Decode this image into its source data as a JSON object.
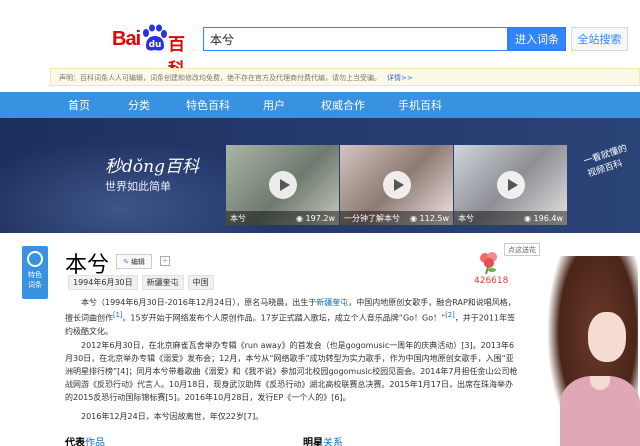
{
  "header": {
    "logo_bai": "Bai",
    "logo_baike": "百科",
    "search_value": "本兮",
    "enter_button": "进入词条",
    "all_search_button": "全站搜索"
  },
  "notice": {
    "text": "声明：百科词条人人可编辑，词条创建和修改均免费，绝不存在官方及代理商付费代编，请勿上当受骗。",
    "more": "详情>>"
  },
  "nav": {
    "items": [
      "首页",
      "分类",
      "特色百科",
      "用户",
      "权威合作",
      "手机百科"
    ]
  },
  "banner": {
    "title": "秒dǒng百科",
    "subtitle": "世界如此简单",
    "handwriting": "一看就懂的视频百科",
    "videos": [
      {
        "caption": "本兮",
        "views": "197.2w"
      },
      {
        "caption": "一分钟了解本兮",
        "views": ""
      },
      {
        "caption": "",
        "views": "112.5w"
      },
      {
        "caption": "本兮",
        "views": "196.4w"
      }
    ]
  },
  "side_tab": {
    "label1": "特色",
    "label2": "词条"
  },
  "entry": {
    "title": "本兮",
    "edit_label": "编辑",
    "tags": [
      "1994年6月30日",
      "新疆奎屯",
      "中国"
    ],
    "flower_tip": "点这送花",
    "flower_count": "426618",
    "p1_a": "本兮（1994年6月30日-2016年12月24日），原名马晓晨，出生于",
    "p1_link1": "新疆奎屯",
    "p1_b": "，中国内地原创女歌手，融合RAP和说唱风格，擅长词曲创作",
    "p1_ref1": "[1]",
    "p1_c": "。15岁开始于网络发布个人原创作品。17岁正式踏入歌坛，成立个人音乐品牌“Go！Go！”",
    "p1_ref2": "[2]",
    "p1_d": "，并于2011年签约极酷文化。",
    "p2": "2012年6月30日，在北京麻雀瓦舍举办专辑《run away》的首发会（也是gogomusic一周年的庆典活动）[3]。2013年6月30日，在北京举办专辑《溺爱》发布会；12月，本兮从“网络歌手”成功转型为实力歌手，作为中国内地原创女歌手，入围“亚洲明星排行榜”[4]；同月本兮带着歌曲《溺爱》和《我不说》参加河北校园gogomusic校园见面会。2014年7月担任金山公司枪战网游《反恐行动》代言人。10月18日，现身武汉助阵《反恐行动》湖北高校联赛总决赛。2015年1月17日，出席在珠海举办的2015反恐行动国际锦标赛[5]。2016年10月28日，发行EP《一个人的》[6]。",
    "p3": "2016年12月24日，本兮因故离世，年仅22岁[7]。",
    "sec1_a": "代表",
    "sec1_b": "作品",
    "sec2_a": "明星",
    "sec2_b": "关系"
  },
  "colors": {
    "brand_red": "#e10602",
    "accent_blue": "#3385ff",
    "nav_blue": "#3892df",
    "link_blue": "#136ec2"
  }
}
